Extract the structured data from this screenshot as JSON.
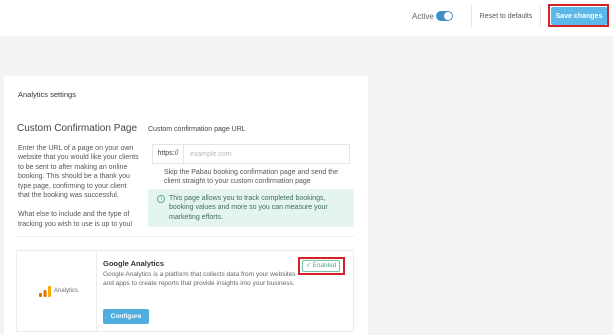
{
  "topbar": {
    "active_label": "Active",
    "active_toggle_on": true,
    "reset_label": "Reset to defaults",
    "save_label": "Save changes"
  },
  "analytics": {
    "section_title": "Analytics settings",
    "confirmation": {
      "title": "Custom Confirmation Page",
      "description_1": "Enter the URL of a page on your own website that you would like your clients to be sent to after making an online booking. This should be a thank you type page, confirming to your client that the booking was successful.",
      "description_2": "What else to include and the type of tracking you wish to use is up to you!",
      "url_label": "Custom confirmation page URL",
      "url_prefix": "https://",
      "url_value": "",
      "url_placeholder": "example.com",
      "skip_text": "Skip the Pabau booking confirmation page and send the client straight to your custom confirmation page",
      "info_text": "This page allows you to track completed bookings, booking values and more so you can measure your marketing efforts."
    },
    "google_analytics": {
      "logo_text": "Analytics",
      "title": "Google Analytics",
      "status": "Enabled",
      "description": "Google Analytics is a platform that collects data from your websites and apps to create reports that provide insights into your business.",
      "configure_label": "Configure"
    }
  },
  "colors": {
    "accent": "#5bb9e9",
    "highlight": "#d32029",
    "enabled_green": "#52aa8c",
    "info_bg": "#e4f4ef"
  },
  "icons": [
    "info-icon",
    "check-icon",
    "google-analytics-logo-icon"
  ]
}
